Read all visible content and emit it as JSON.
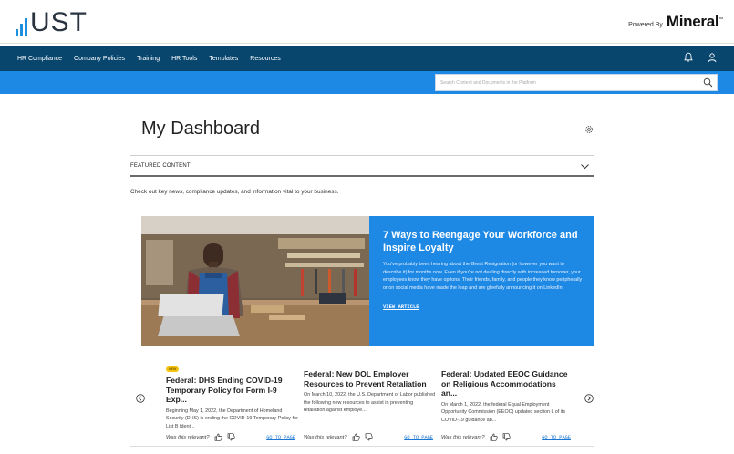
{
  "brand": {
    "logo_text": "UST",
    "powered_by": "Powered By",
    "partner": "Mineral",
    "partner_mark": "™"
  },
  "nav": {
    "items": [
      "HR Compliance",
      "Company Policies",
      "Training",
      "HR Tools",
      "Templates",
      "Resources"
    ],
    "icons": [
      "bell-icon",
      "user-icon"
    ]
  },
  "search": {
    "placeholder": "Search Content and Documents in the Platform"
  },
  "dashboard": {
    "title": "My Dashboard"
  },
  "featured": {
    "label": "FEATURED CONTENT",
    "intro": "Check out key news, compliance updates, and information vital to your business."
  },
  "hero": {
    "title": "7 Ways to Reengage Your Workforce and Inspire Loyalty",
    "body": "You've probably been hearing about the Great Resignation (or however you want to describe it) for months now. Even if you're not dealing directly with increased turnover, your employees know they have options. Their friends, family, and people they know peripherally or on social media have made the leap and are gleefully announcing it on LinkedIn.",
    "link": "VIEW ARTICLE"
  },
  "cards": [
    {
      "badge": "NEW",
      "title": "Federal: DHS Ending COVID-19 Temporary Policy for Form I-9 Exp...",
      "body": "Beginning May 1, 2022, the Department of Homeland Security (DHS) is ending the COVID-19 Temporary Policy for List B Ident...",
      "relevant": "Was this relevant?",
      "link": "GO TO PAGE"
    },
    {
      "title": "Federal: New DOL Employer Resources to Prevent Retaliation",
      "body": "On March 10, 2022, the U.S. Department of Labor published the following new resources to assist in preventing retaliation against employe...",
      "relevant": "Was this relevant?",
      "link": "GO TO PAGE"
    },
    {
      "title": "Federal: Updated EEOC Guidance on Religious Accommodations an...",
      "body": "On March 1, 2022, the federal Equal Employment Opportunity Commission (EEOC) updated section L of its COVID-19 guidance ab...",
      "relevant": "Was this relevant?",
      "link": "GO TO PAGE"
    }
  ],
  "colors": {
    "nav": "#08466e",
    "accent": "#1e88e5",
    "badge": "#f4c40f",
    "link": "#1976d2"
  }
}
